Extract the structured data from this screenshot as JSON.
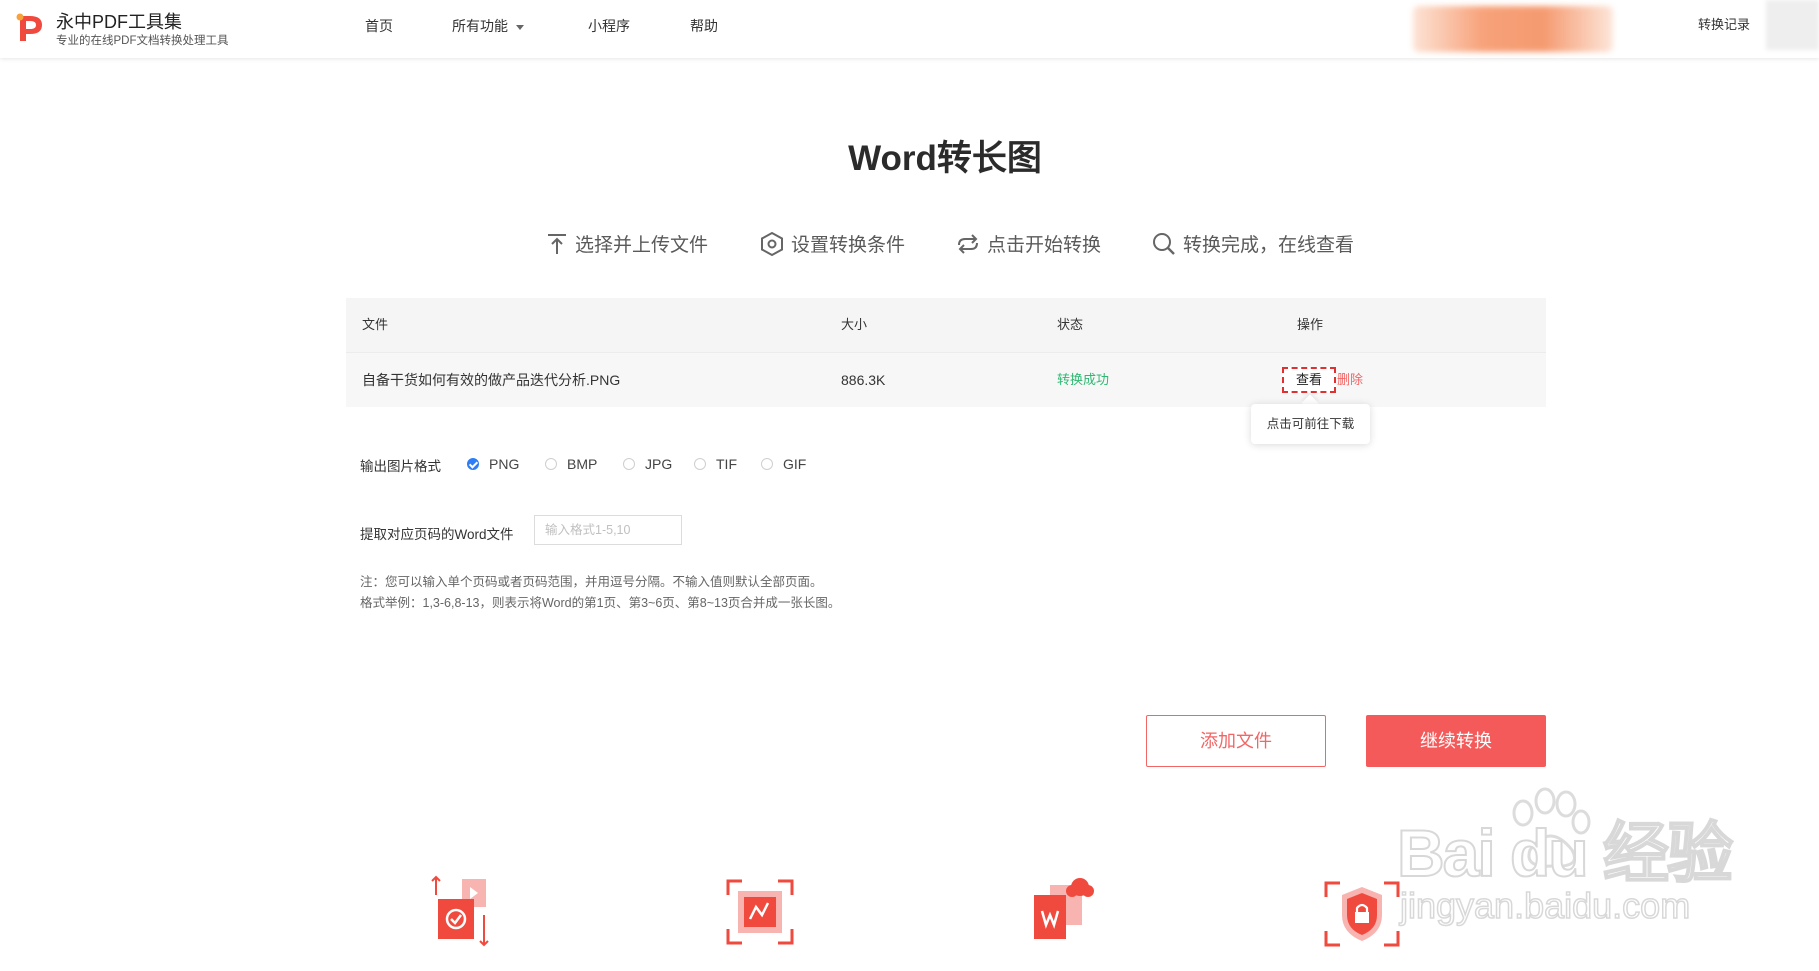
{
  "header": {
    "brand_name": "永中PDF工具集",
    "brand_sub": "专业的在线PDF文档转换处理工具",
    "nav": [
      {
        "label": "首页"
      },
      {
        "label": "所有功能"
      },
      {
        "label": "小程序"
      },
      {
        "label": "帮助"
      }
    ],
    "record_label": "转换记录"
  },
  "page": {
    "title": "Word转长图"
  },
  "steps": [
    {
      "label": "选择并上传文件",
      "icon": "upload-icon"
    },
    {
      "label": "设置转换条件",
      "icon": "settings-icon"
    },
    {
      "label": "点击开始转换",
      "icon": "convert-icon"
    },
    {
      "label": "转换完成，在线查看",
      "icon": "search-icon"
    }
  ],
  "table": {
    "headers": {
      "file": "文件",
      "size": "大小",
      "status": "状态",
      "action": "操作"
    },
    "rows": [
      {
        "file": "自备干货如何有效的做产品迭代分析.PNG",
        "size": "886.3K",
        "status": "转换成功",
        "view_label": "查看",
        "delete_label": "删除"
      }
    ],
    "tooltip": "点击可前往下载"
  },
  "options": {
    "format_label": "输出图片格式",
    "formats": [
      "PNG",
      "BMP",
      "JPG",
      "TIF",
      "GIF"
    ],
    "selected_format": "PNG",
    "range_label": "提取对应页码的Word文件",
    "range_value": "",
    "range_placeholder": "输入格式1-5,10",
    "note_line1": "注：您可以输入单个页码或者页码范围，并用逗号分隔。不输入值则默认全部页面。",
    "note_line2": "格式举例：1,3-6,8-13，则表示将Word的第1页、第3~6页、第8~13页合并成一张长图。"
  },
  "actions": {
    "add_label": "添加文件",
    "continue_label": "继续转换"
  },
  "features": [
    {
      "icon": "upload-check-icon"
    },
    {
      "icon": "image-frame-icon"
    },
    {
      "icon": "word-cloud-icon"
    },
    {
      "icon": "security-lock-icon"
    }
  ],
  "watermark": {
    "line1": "Bai du 经验",
    "line2": "jingyan.baidu.com"
  },
  "colors": {
    "accent": "#f45a5a",
    "success": "#2eb872",
    "radio_checked": "#2d7ef7"
  }
}
